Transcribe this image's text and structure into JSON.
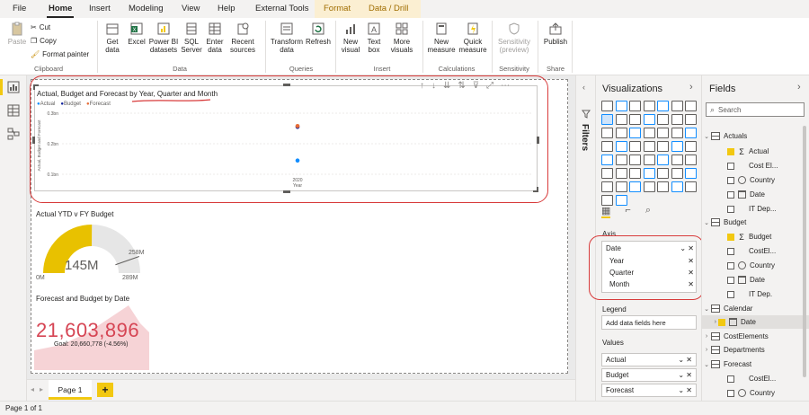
{
  "menu": {
    "tabs": [
      "File",
      "Home",
      "Insert",
      "Modeling",
      "View",
      "Help",
      "External Tools",
      "Format",
      "Data / Drill"
    ]
  },
  "ribbon": {
    "clipboard": {
      "paste": "Paste",
      "cut": "Cut",
      "copy": "Copy",
      "format_painter": "Format painter",
      "group": "Clipboard"
    },
    "data": {
      "get_data": "Get data",
      "excel": "Excel",
      "power_bi": "Power BI datasets",
      "sql": "SQL Server",
      "enter": "Enter data",
      "recent": "Recent sources",
      "group": "Data"
    },
    "queries": {
      "transform": "Transform data",
      "refresh": "Refresh",
      "group": "Queries"
    },
    "insert": {
      "new_visual": "New visual",
      "text_box": "Text box",
      "more_visuals": "More visuals",
      "group": "Insert"
    },
    "calculations": {
      "new_measure": "New measure",
      "quick_measure": "Quick measure",
      "group": "Calculations"
    },
    "sensitivity": {
      "label": "Sensitivity (preview)",
      "group": "Sensitivity"
    },
    "share": {
      "publish": "Publish",
      "group": "Share"
    }
  },
  "chart1": {
    "title": "Actual, Budget and Forecast by Year, Quarter and Month",
    "legend": [
      "Actual",
      "Budget",
      "Forecast"
    ],
    "chart_data": {
      "type": "scatter",
      "title": "Actual, Budget and Forecast by Year, Quarter and Month",
      "xlabel": "Year",
      "ylabel": "Actual, Budget and Forecast",
      "categories": [
        "2020"
      ],
      "yticks": [
        "0.3bn",
        "0.2bn",
        "0.1bn"
      ],
      "ylim": [
        0.1,
        0.3
      ],
      "series": [
        {
          "name": "Actual",
          "color": "#118dff",
          "values": [
            0.145
          ]
        },
        {
          "name": "Budget",
          "color": "#12239e",
          "values": [
            0.255
          ]
        },
        {
          "name": "Forecast",
          "color": "#e66c37",
          "values": [
            0.258
          ]
        }
      ]
    }
  },
  "gauge": {
    "title": "Actual YTD v FY Budget",
    "value": "145M",
    "min": "0M",
    "max": "289M",
    "target": "258M",
    "fraction": 0.502
  },
  "kpi": {
    "title": "Forecast and Budget by Date",
    "value": "21,603,896",
    "goal": "Goal: 20,660,778 (-4.56%)"
  },
  "pages": {
    "tab": "Page 1",
    "add": "+"
  },
  "status": {
    "text": "Page 1 of 1"
  },
  "filters": {
    "label": "Filters"
  },
  "viz": {
    "title": "Visualizations",
    "axis_label": "Axis",
    "axis_fields": [
      "Date",
      "Year",
      "Quarter",
      "Month"
    ],
    "legend_label": "Legend",
    "legend_placeholder": "Add data fields here",
    "values_label": "Values",
    "values_fields": [
      "Actual",
      "Budget",
      "Forecast"
    ]
  },
  "fields": {
    "title": "Fields",
    "search_placeholder": "Search",
    "tables": [
      {
        "name": "Actuals",
        "items": [
          "Actual",
          "Cost El...",
          "Country",
          "Date",
          "IT Dep..."
        ]
      },
      {
        "name": "Budget",
        "items": [
          "Budget",
          "CostEl...",
          "Country",
          "Date",
          "IT Dep."
        ]
      },
      {
        "name": "Calendar",
        "items": [
          "Date"
        ]
      },
      {
        "name": "CostElements"
      },
      {
        "name": "Departments"
      },
      {
        "name": "Forecast",
        "items": [
          "CostEl...",
          "Country"
        ]
      }
    ]
  },
  "colors": {
    "accent": "#f2c811",
    "kpi_red": "#d64554",
    "annotation": "#d83b3b"
  }
}
